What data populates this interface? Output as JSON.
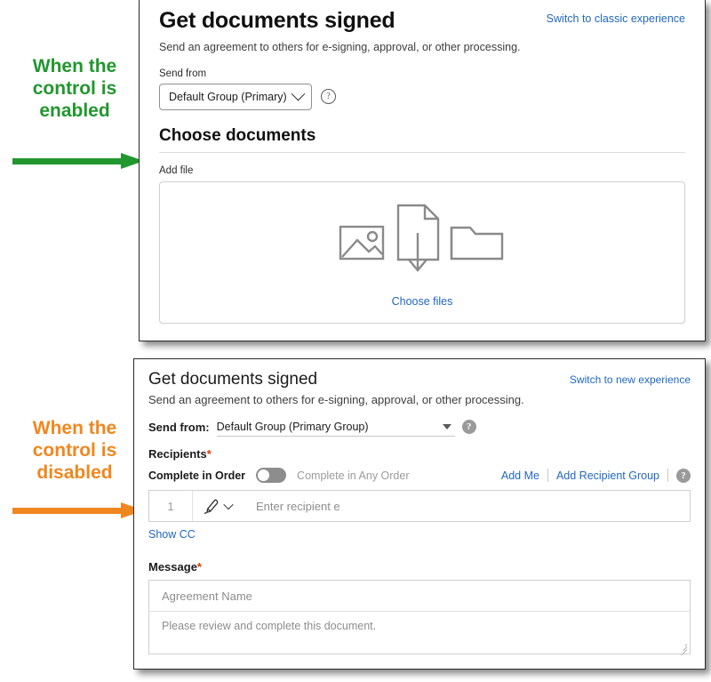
{
  "annotations": {
    "enabled": {
      "lines": [
        "When the",
        "control is",
        "enabled"
      ],
      "color": "#22962f"
    },
    "disabled": {
      "lines": [
        "When the",
        "control is",
        "disabled"
      ],
      "color": "#f0871e"
    }
  },
  "new_experience": {
    "title": "Get documents signed",
    "subtitle": "Send an agreement to others for e-signing, approval, or other processing.",
    "switch_link": "Switch to classic experience",
    "send_from_label": "Send from",
    "send_from_value": "Default Group (Primary)",
    "help_icon": "help-circle-icon",
    "section_title": "Choose documents",
    "add_file_label": "Add file",
    "dropzone_icons": [
      "image-icon",
      "document-upload-icon",
      "folder-icon"
    ],
    "choose_files_link": "Choose files"
  },
  "classic_experience": {
    "title": "Get documents signed",
    "subtitle": "Send an agreement to others for e-signing, approval, or other processing.",
    "switch_link": "Switch to new experience",
    "send_from_label": "Send from:",
    "send_from_value": "Default Group (Primary Group)",
    "recipients_label": "Recipients",
    "required_mark": "*",
    "complete_in_order_label": "Complete in Order",
    "complete_any_order_label": "Complete in Any Order",
    "toggle_state": "off",
    "add_me_link": "Add Me",
    "add_recipient_group_link": "Add Recipient Group",
    "recipient_row": {
      "number": "1",
      "role_icon": "signature-pen-icon",
      "placeholder": "Enter recipient e"
    },
    "show_cc_link": "Show CC",
    "message_label": "Message",
    "message_required_mark": "*",
    "agreement_name_placeholder": "Agreement Name",
    "message_body_placeholder": "Please review and complete this document."
  },
  "colors": {
    "link": "#2167c0",
    "green": "#22962f",
    "orange": "#f0871e",
    "required": "#d83b01"
  }
}
